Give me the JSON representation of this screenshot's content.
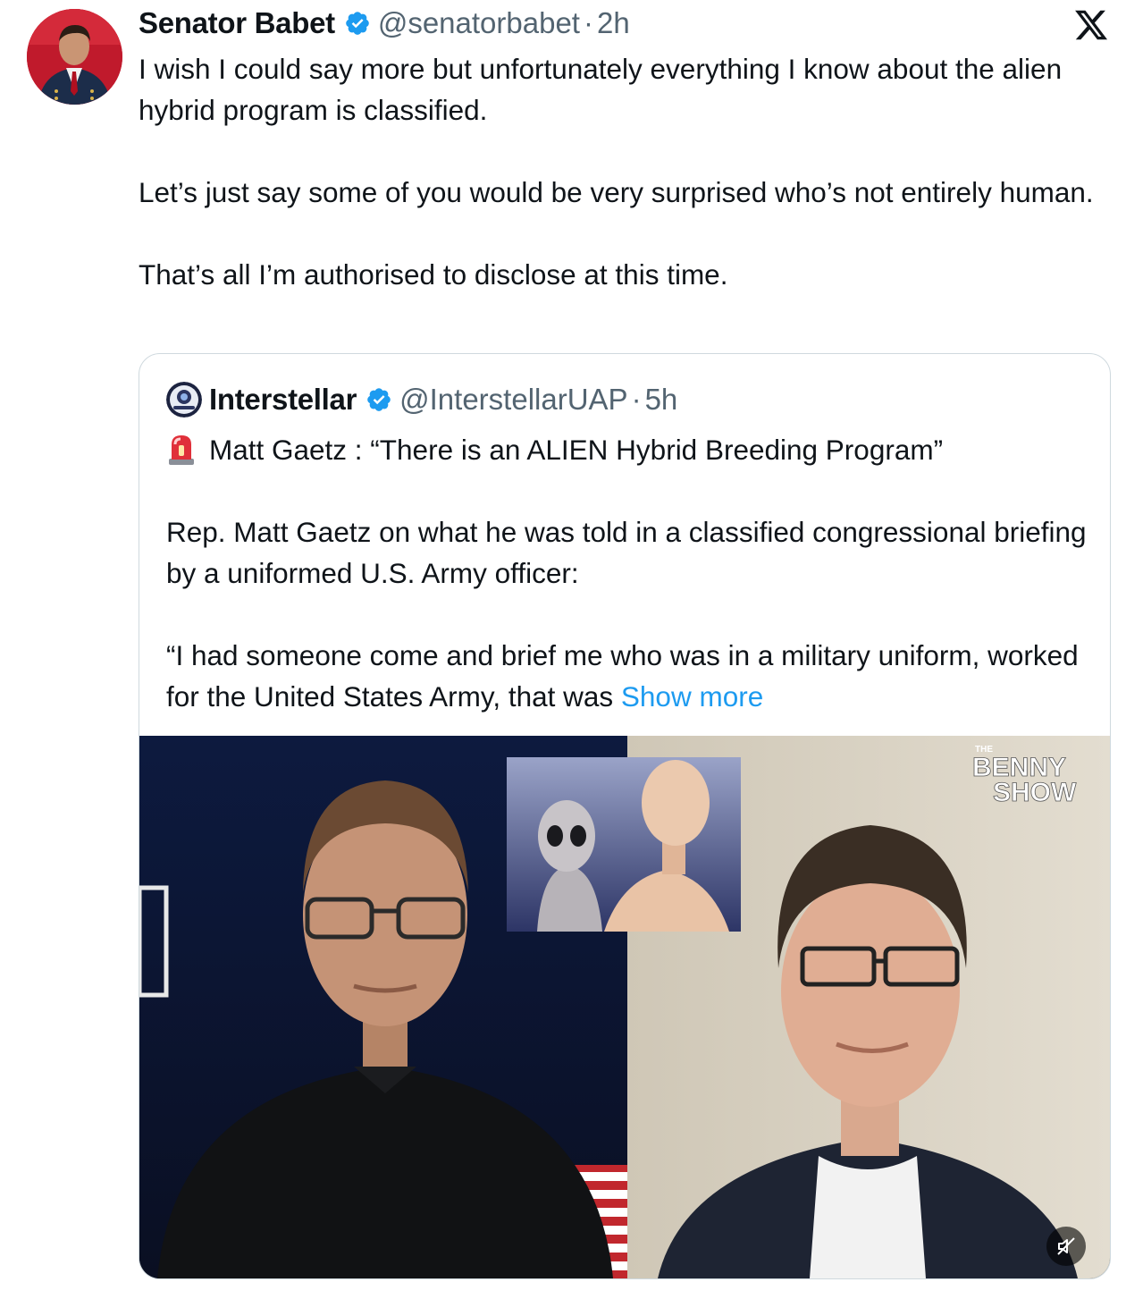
{
  "tweet": {
    "author_name": "Senator Babet",
    "handle": "@senatorbabet",
    "separator": "·",
    "time": "2h",
    "paragraphs": [
      "I wish I could say more but unfortunately everything I know about the alien hybrid program is classified.",
      "Let’s just say some of you would be very surprised who’s not entirely human.",
      "That’s all I’m authorised to disclose at this time."
    ]
  },
  "quoted": {
    "author_name": "Interstellar",
    "handle": "@InterstellarUAP",
    "separator": "·",
    "time": "5h",
    "headline": "Matt Gaetz : “There is an ALIEN Hybrid Breeding Program”",
    "paragraph2": "Rep. Matt Gaetz on what he was told in a classified congressional briefing by a uniformed U.S. Army officer:",
    "paragraph3": "“I had someone come and brief me who was in a military uniform, worked for the United States Army, that was ",
    "show_more": "Show more"
  },
  "media": {
    "watermark_top": "THE",
    "watermark_line1": "BENNY",
    "watermark_line2": "SHOW"
  },
  "icons": {
    "verified": "verified-badge-icon",
    "platform": "x-logo-icon",
    "siren": "rotating-light-icon",
    "mute": "mute-icon"
  },
  "colors": {
    "verified": "#1d9bf0",
    "link": "#1d9bf0",
    "secondary_text": "#536471",
    "border": "#cfd9de"
  }
}
